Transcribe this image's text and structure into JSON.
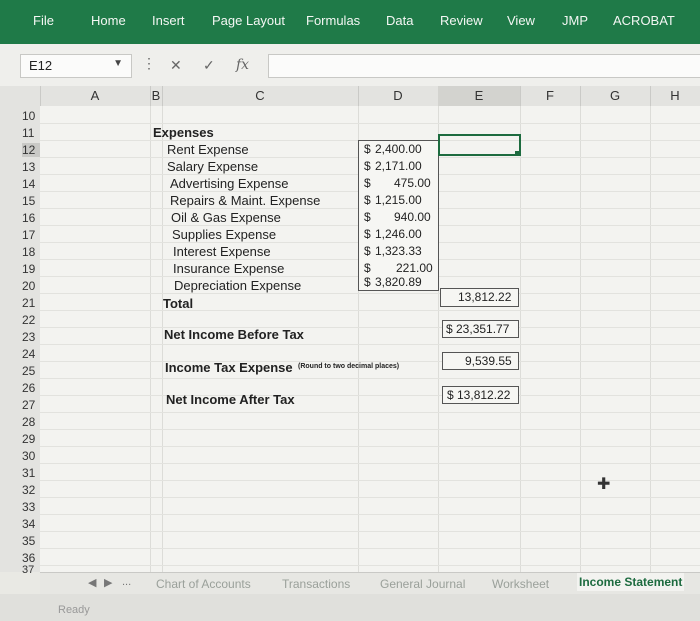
{
  "ribbon": {
    "tabs": [
      "File",
      "Home",
      "Insert",
      "Page Layout",
      "Formulas",
      "Data",
      "Review",
      "View",
      "JMP",
      "ACROBAT"
    ]
  },
  "formula_bar": {
    "name_box": "E12",
    "fx_symbol": "fx",
    "cancel_symbol": "✕",
    "enter_symbol": "✓",
    "formula": ""
  },
  "columns": [
    "A",
    "B",
    "C",
    "D",
    "E",
    "F",
    "G",
    "H"
  ],
  "rows": [
    "10",
    "11",
    "12",
    "13",
    "14",
    "15",
    "16",
    "17",
    "18",
    "19",
    "20",
    "21",
    "22",
    "23",
    "24",
    "25",
    "26",
    "27",
    "28",
    "29",
    "30",
    "31",
    "32",
    "33",
    "34",
    "35",
    "36",
    "37"
  ],
  "sheet": {
    "expenses_heading": "Expenses",
    "expense_items": [
      {
        "label": "Rent Expense",
        "symbol": "$",
        "amount": "2,400.00"
      },
      {
        "label": "Salary Expense",
        "symbol": "$",
        "amount": "2,171.00"
      },
      {
        "label": "Advertising Expense",
        "symbol": "$",
        "amount": "475.00"
      },
      {
        "label": "Repairs & Maint. Expense",
        "symbol": "$",
        "amount": "1,215.00"
      },
      {
        "label": "Oil & Gas Expense",
        "symbol": "$",
        "amount": "940.00"
      },
      {
        "label": "Supplies Expense",
        "symbol": "$",
        "amount": "1,246.00"
      },
      {
        "label": "Interest Expense",
        "symbol": "$",
        "amount": "1,323.33"
      },
      {
        "label": "Insurance Expense",
        "symbol": "$",
        "amount": "221.00"
      },
      {
        "label": "Depreciation Expense",
        "symbol": "$",
        "amount": "3,820.89"
      }
    ],
    "total_label": "Total",
    "total_value": "13,812.22",
    "net_income_before_tax_label": "Net Income Before Tax",
    "net_income_before_tax_value": "$ 23,351.77",
    "income_tax_label": "Income Tax Expense",
    "income_tax_note": "(Round to two decimal places)",
    "income_tax_value": "9,539.55",
    "net_income_after_tax_label": "Net Income After Tax",
    "net_income_after_tax_value": "$ 13,812.22"
  },
  "sheet_tabs": {
    "nav_prev": "◀",
    "nav_next": "▶",
    "ellipsis": "...",
    "tabs": [
      "Chart of Accounts",
      "Transactions",
      "General Journal",
      "Worksheet",
      "Income Statement"
    ],
    "active": "Income Statement"
  },
  "status": {
    "text": "Ready"
  },
  "icons": {
    "name_box_dropdown": "chevron-down-icon",
    "cursor": "plus-cursor-icon"
  }
}
